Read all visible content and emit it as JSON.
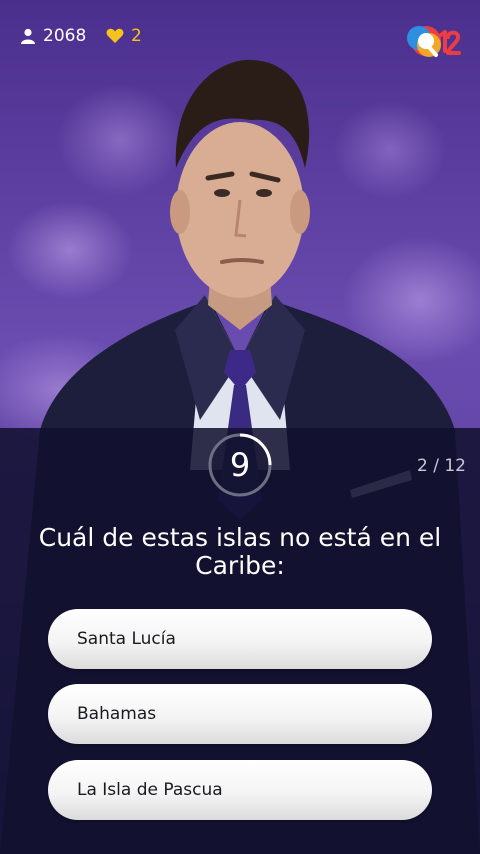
{
  "top_bar": {
    "players_count": "2068",
    "lives_count": "2",
    "logo_icon": "q12-logo-icon"
  },
  "quiz": {
    "timer": "9",
    "progress": "2 / 12",
    "question": "Cuál de estas islas no está en el Caribe:",
    "answers": [
      {
        "label": "Santa Lucía"
      },
      {
        "label": "Bahamas"
      },
      {
        "label": "La Isla de Pascua"
      }
    ]
  },
  "colors": {
    "accent_heart": "#f6c21c",
    "panel": "#10102e",
    "answer_text": "#1a1a22"
  }
}
